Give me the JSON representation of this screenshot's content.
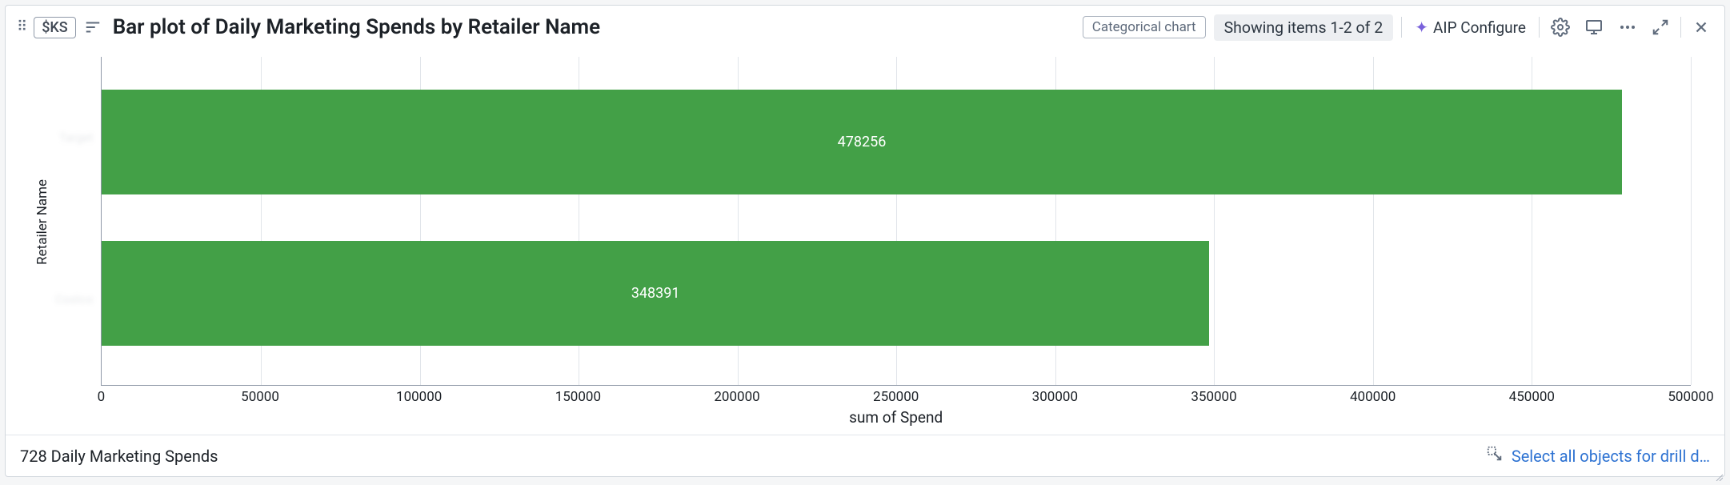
{
  "header": {
    "var_chip": "$KS",
    "title": "Bar plot of Daily Marketing Spends by Retailer Name",
    "chart_type_chip": "Categorical chart",
    "showing_chip": "Showing items 1-2 of 2",
    "aip_label": "AIP Configure"
  },
  "chart_data": {
    "type": "bar",
    "orientation": "horizontal",
    "ylabel": "Retailer Name",
    "xlabel": "sum of Spend",
    "xlim": [
      0,
      500000
    ],
    "xticks": [
      0,
      50000,
      100000,
      150000,
      200000,
      250000,
      300000,
      350000,
      400000,
      450000,
      500000
    ],
    "bar_color": "#43a047",
    "categories": [
      "",
      ""
    ],
    "values": [
      478256,
      348391
    ]
  },
  "ticks": {
    "x0": "0",
    "x1": "50000",
    "x2": "100000",
    "x3": "150000",
    "x4": "200000",
    "x5": "250000",
    "x6": "300000",
    "x7": "350000",
    "x8": "400000",
    "x9": "450000",
    "x10": "500000"
  },
  "bars": {
    "v0": "478256",
    "v1": "348391"
  },
  "footer": {
    "count_text": "728 Daily Marketing Spends",
    "drill_text": "Select all objects for drill d…"
  }
}
